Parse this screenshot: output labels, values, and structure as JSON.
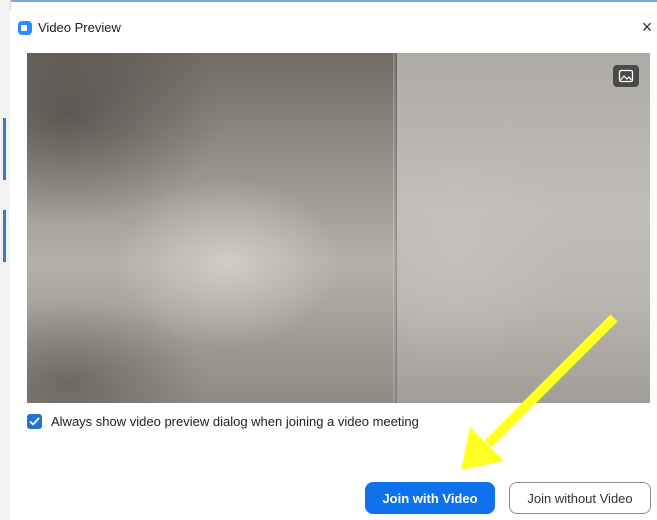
{
  "window": {
    "title": "Video Preview",
    "close_glyph": "×",
    "icon": "zoom-app-icon"
  },
  "video": {
    "background_button_icon": "image-icon"
  },
  "preview_option": {
    "checked": true,
    "label": "Always show video preview dialog when joining a video meeting"
  },
  "buttons": {
    "join_with_video": "Join with Video",
    "join_without_video": "Join without Video"
  },
  "annotation": {
    "type": "arrow",
    "color": "#ffff22",
    "points_to": "join-with-video-button"
  },
  "colors": {
    "primary": "#0e72ed",
    "checkbox": "#1f74d6"
  }
}
